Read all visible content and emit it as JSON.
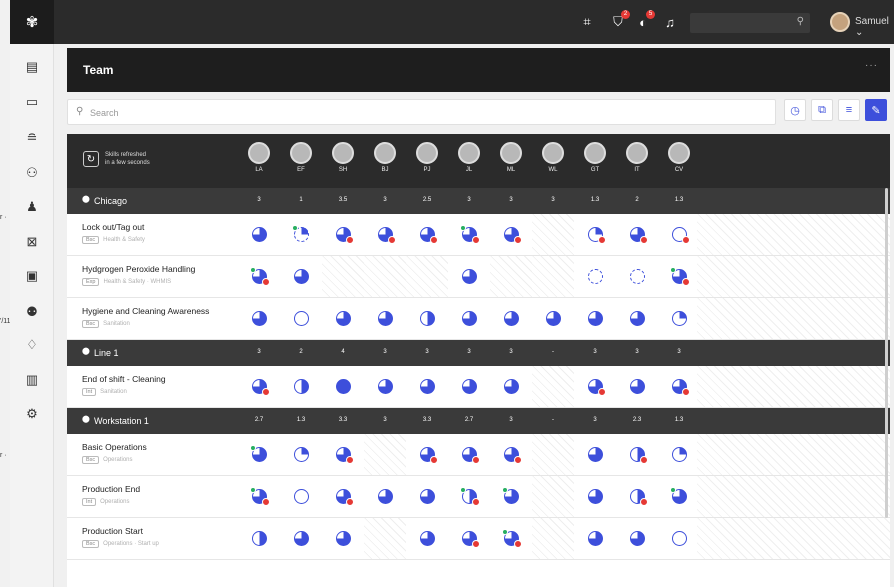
{
  "ghost": {
    "frag1": "'/11",
    "frag2": "r ·",
    "frag3": "r ·"
  },
  "topbar": {
    "user_name": "Samuel ⌄",
    "badge1": "2",
    "badge2": "5"
  },
  "team": {
    "title": "Team",
    "more": "···"
  },
  "search": {
    "placeholder": "Search"
  },
  "header": {
    "refresh_line1": "Skills refreshed",
    "refresh_line2": "in a few seconds"
  },
  "employees": [
    "LA",
    "EF",
    "SH",
    "BJ",
    "PJ",
    "JL",
    "ML",
    "WL",
    "GT",
    "IT",
    "CV"
  ],
  "groups": [
    {
      "name": "Chicago",
      "values": [
        "3",
        "1",
        "3.5",
        "3",
        "2.5",
        "3",
        "3",
        "3",
        "1.3",
        "2",
        "1.3"
      ],
      "skills": [
        {
          "name": "Lock out/Tag out",
          "level": "Bsc",
          "cat": "Health & Safety",
          "cells": [
            {
              "f": 0.75
            },
            {
              "f": 0.25,
              "d": 1,
              "g": 1
            },
            {
              "f": 0.75,
              "r": 1
            },
            {
              "f": 0.75,
              "r": 1
            },
            {
              "f": 0.75,
              "r": 1
            },
            {
              "f": 0.75,
              "r": 1,
              "g": 1
            },
            {
              "f": 0.75,
              "r": 1
            },
            {
              "na": 1
            },
            {
              "f": 0.25,
              "r": 1
            },
            {
              "f": 0.75,
              "r": 1
            },
            {
              "f": 0,
              "r": 1
            }
          ]
        },
        {
          "name": "Hydgrogen Peroxide Handling",
          "level": "Exp",
          "cat": "Health & Safety · WHMIS",
          "cells": [
            {
              "f": 0.75,
              "r": 1,
              "g": 1
            },
            {
              "f": 0.75
            },
            {
              "na": 1
            },
            {
              "na": 1
            },
            {
              "na": 1
            },
            {
              "f": 0.75
            },
            {
              "na": 1
            },
            {
              "na": 1
            },
            {
              "f": 0,
              "d": 1
            },
            {
              "f": 0,
              "d": 1
            },
            {
              "f": 0.75,
              "r": 1,
              "g": 1
            }
          ]
        },
        {
          "name": "Hygiene and Cleaning Awareness",
          "level": "Bsc",
          "cat": "Sanitation",
          "cells": [
            {
              "f": 0.75
            },
            {
              "f": 0
            },
            {
              "f": 0.75
            },
            {
              "f": 0.75
            },
            {
              "f": 0.5
            },
            {
              "f": 0.75
            },
            {
              "f": 0.75
            },
            {
              "f": 0.75
            },
            {
              "f": 0.75
            },
            {
              "f": 0.75
            },
            {
              "f": 0.25
            }
          ]
        }
      ]
    },
    {
      "name": "Line 1",
      "values": [
        "3",
        "2",
        "4",
        "3",
        "3",
        "3",
        "3",
        "-",
        "3",
        "3",
        "3"
      ],
      "skills": [
        {
          "name": "End of shift - Cleaning",
          "level": "Int",
          "cat": "Sanitation",
          "cells": [
            {
              "f": 0.75,
              "r": 1
            },
            {
              "f": 0.5
            },
            {
              "f": 1
            },
            {
              "f": 0.75
            },
            {
              "f": 0.75
            },
            {
              "f": 0.75
            },
            {
              "f": 0.75
            },
            {
              "na": 1
            },
            {
              "f": 0.75,
              "r": 1
            },
            {
              "f": 0.75
            },
            {
              "f": 0.75,
              "r": 1
            }
          ]
        }
      ]
    },
    {
      "name": "Workstation 1",
      "values": [
        "2.7",
        "1.3",
        "3.3",
        "3",
        "3.3",
        "2.7",
        "3",
        "-",
        "3",
        "2.3",
        "1.3"
      ],
      "skills": [
        {
          "name": "Basic Operations",
          "level": "Bsc",
          "cat": "Operations",
          "cells": [
            {
              "f": 0.75,
              "g": 1
            },
            {
              "f": 0.25
            },
            {
              "f": 0.75,
              "r": 1
            },
            {
              "na": 1
            },
            {
              "f": 0.75,
              "r": 1
            },
            {
              "f": 0.75,
              "r": 1
            },
            {
              "f": 0.75,
              "r": 1
            },
            {
              "na": 1
            },
            {
              "f": 0.75
            },
            {
              "f": 0.5,
              "r": 1
            },
            {
              "f": 0.25
            }
          ]
        },
        {
          "name": "Production End",
          "level": "Int",
          "cat": "Operations",
          "cells": [
            {
              "f": 0.75,
              "r": 1,
              "g": 1
            },
            {
              "f": 0
            },
            {
              "f": 0.75,
              "r": 1
            },
            {
              "f": 0.75
            },
            {
              "f": 0.75
            },
            {
              "f": 0.5,
              "r": 1,
              "g": 1
            },
            {
              "f": 0.75,
              "g": 1
            },
            {
              "na": 1
            },
            {
              "f": 0.75
            },
            {
              "f": 0.5,
              "r": 1
            },
            {
              "f": 0.75,
              "g": 1
            }
          ]
        },
        {
          "name": "Production Start",
          "level": "Bsc",
          "cat": "Operations · Start up",
          "cells": [
            {
              "f": 0.5
            },
            {
              "f": 0.75
            },
            {
              "f": 0.75
            },
            {
              "na": 1
            },
            {
              "f": 0.75
            },
            {
              "f": 0.75,
              "r": 1
            },
            {
              "f": 0.75,
              "r": 1,
              "g": 1
            },
            {
              "na": 1
            },
            {
              "f": 0.75
            },
            {
              "f": 0.75
            },
            {
              "f": 0
            }
          ]
        }
      ]
    }
  ],
  "colors": {
    "accent": "#3d4fdb",
    "danger": "#e53935",
    "ok": "#27ae60",
    "dark": "#1e1e1e"
  }
}
